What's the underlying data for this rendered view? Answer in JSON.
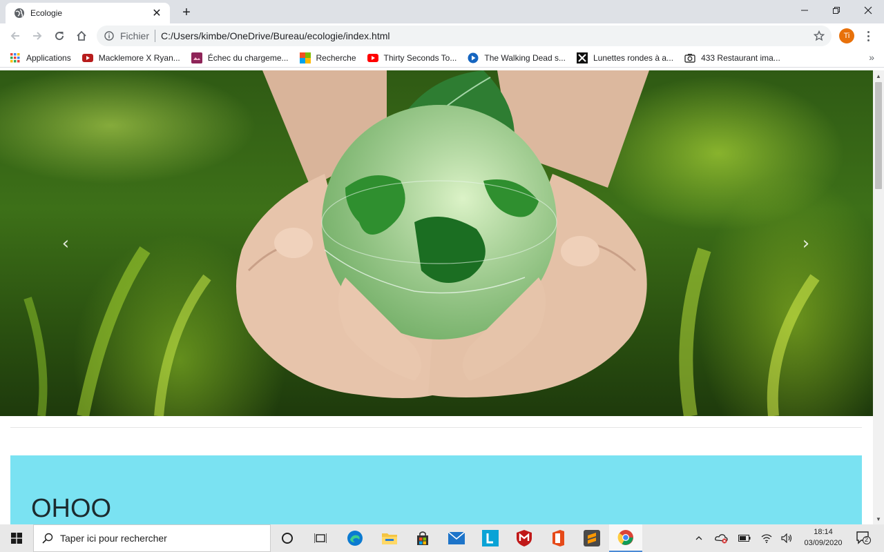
{
  "browser": {
    "tab_title": "Ecologie",
    "new_tab_label": "+",
    "url_scheme_label": "Fichier",
    "url": "C:/Users/kimbe/OneDrive/Bureau/ecologie/index.html",
    "profile_initials": "Ti"
  },
  "bookmarks": [
    {
      "label": "Applications",
      "icon": "apps-grid-icon"
    },
    {
      "label": "Macklemore X Ryan...",
      "icon": "youtube-icon"
    },
    {
      "label": "Échec du chargeme...",
      "icon": "broken-image-icon"
    },
    {
      "label": "Recherche",
      "icon": "search-app-icon"
    },
    {
      "label": "Thirty Seconds To...",
      "icon": "youtube-icon"
    },
    {
      "label": "The Walking Dead s...",
      "icon": "play-circle-icon"
    },
    {
      "label": "Lunettes rondes à a...",
      "icon": "x-logo-icon"
    },
    {
      "label": "433 Restaurant ima...",
      "icon": "camera-icon"
    }
  ],
  "page": {
    "carousel_prev": "‹",
    "carousel_next": "›",
    "jumbotron_heading": "OHOO"
  },
  "taskbar": {
    "search_placeholder": "Taper ici pour rechercher",
    "time": "18:14",
    "date": "03/09/2020",
    "notification_count": "2"
  },
  "colors": {
    "jumbotron_bg": "#7ae2f2",
    "avatar_bg": "#e8710a"
  }
}
